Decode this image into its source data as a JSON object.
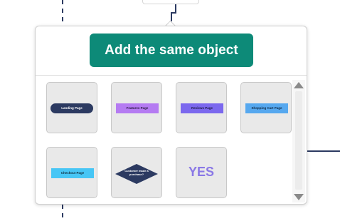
{
  "popover": {
    "button_label": "Add the same object"
  },
  "shapes": [
    {
      "label": "Landing Page",
      "fill": "#2c3a61",
      "text_color": "#ffffff",
      "kind": "rounded-rectangle"
    },
    {
      "label": "Features Page",
      "fill": "#b57bf2",
      "text_color": "#2a1a40",
      "kind": "rectangle"
    },
    {
      "label": "Reviews Page",
      "fill": "#7b68ee",
      "text_color": "#1e1a45",
      "kind": "rectangle"
    },
    {
      "label": "Shopping Cart Page",
      "fill": "#56a8ef",
      "text_color": "#0f2a45",
      "kind": "rectangle"
    },
    {
      "label": "Checkout Page",
      "fill": "#47c6f5",
      "text_color": "#0f2d3d",
      "kind": "rectangle"
    },
    {
      "label": "Customer made a purchase?",
      "fill": "#2c3a61",
      "text_color": "#ffffff",
      "kind": "diamond"
    },
    {
      "label": "YES",
      "fill": "none",
      "text_color": "#8a78e6",
      "kind": "text"
    }
  ],
  "scrollbar": {
    "up_icon": "triangle-up-icon",
    "down_icon": "triangle-down-icon",
    "arrow_color": "#8a8a8a"
  },
  "colors": {
    "accent": "#0d8a78",
    "connector": "#2c3a61"
  }
}
